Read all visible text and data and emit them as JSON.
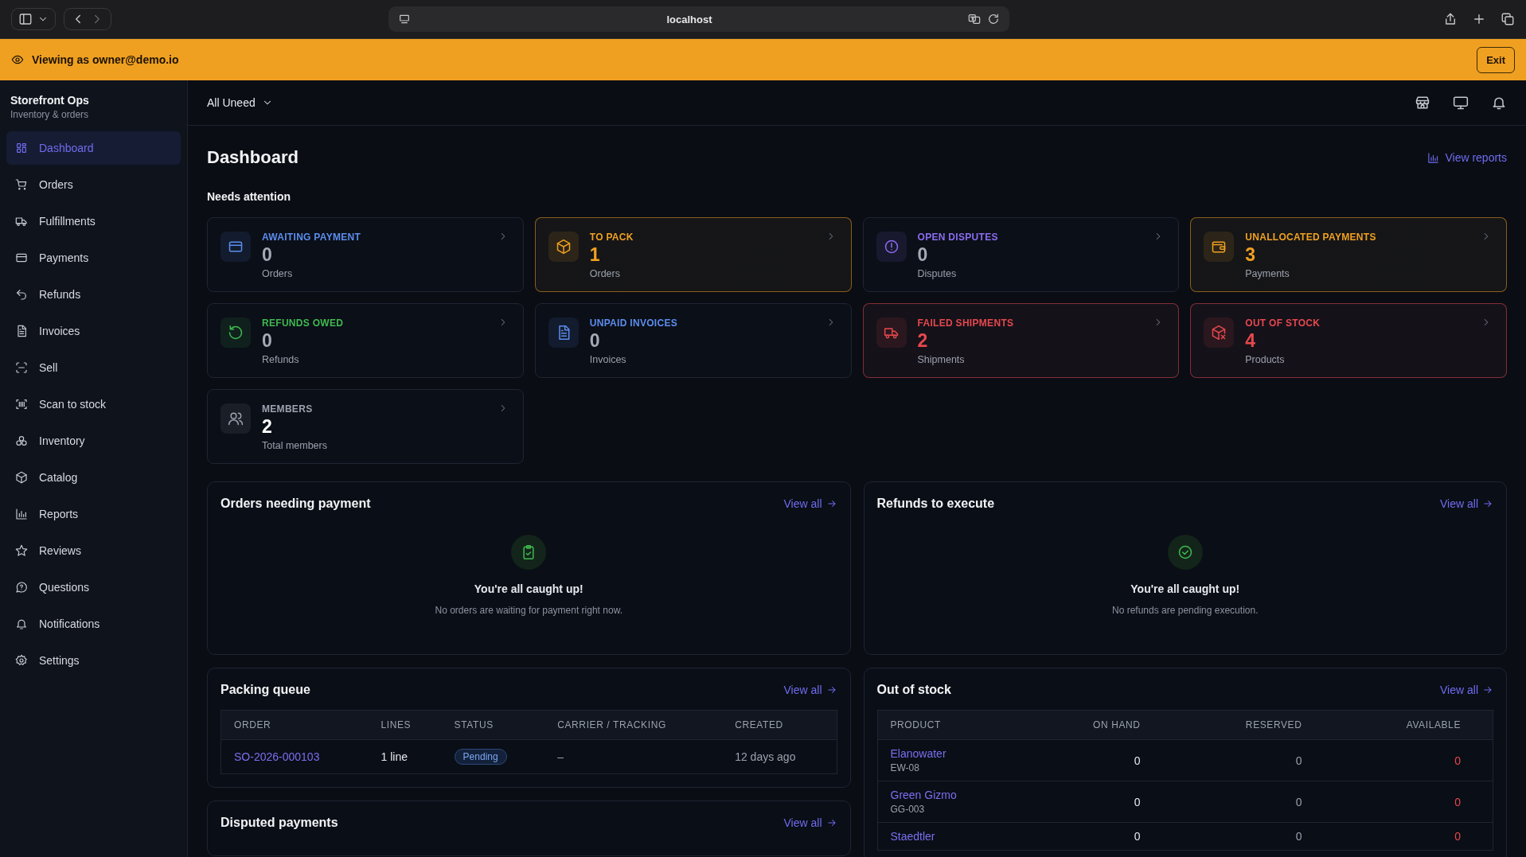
{
  "browser": {
    "address": "localhost"
  },
  "banner": {
    "text": "Viewing as owner@demo.io",
    "button": "Exit"
  },
  "sidebar": {
    "title": "Storefront Ops",
    "subtitle": "Inventory & orders",
    "items": [
      {
        "label": "Dashboard",
        "selected": true
      },
      {
        "label": "Orders",
        "selected": false
      },
      {
        "label": "Fulfillments",
        "selected": false
      },
      {
        "label": "Payments",
        "selected": false
      },
      {
        "label": "Refunds",
        "selected": false
      },
      {
        "label": "Invoices",
        "selected": false
      },
      {
        "label": "Sell",
        "selected": false
      },
      {
        "label": "Scan to stock",
        "selected": false
      },
      {
        "label": "Inventory",
        "selected": false
      },
      {
        "label": "Catalog",
        "selected": false
      },
      {
        "label": "Reports",
        "selected": false
      },
      {
        "label": "Reviews",
        "selected": false
      },
      {
        "label": "Questions",
        "selected": false
      },
      {
        "label": "Notifications",
        "selected": false
      },
      {
        "label": "Settings",
        "selected": false
      }
    ]
  },
  "topbar": {
    "selector": "All Uneed"
  },
  "page": {
    "title": "Dashboard",
    "action": "View reports",
    "section": "Needs attention"
  },
  "cards": [
    {
      "label": "AWAITING PAYMENT",
      "count": "0",
      "unit": "Orders",
      "color": "#5b8def",
      "highlighted": false,
      "dimmed": true
    },
    {
      "label": "TO PACK",
      "count": "1",
      "unit": "Orders",
      "color": "#f0a020",
      "highlighted": true,
      "dimmed": false
    },
    {
      "label": "OPEN DISPUTES",
      "count": "0",
      "unit": "Disputes",
      "color": "#8b6cf0",
      "highlighted": false,
      "dimmed": true
    },
    {
      "label": "UNALLOCATED PAYMENTS",
      "count": "3",
      "unit": "Payments",
      "color": "#f0a020",
      "highlighted": true,
      "dimmed": false
    },
    {
      "label": "REFUNDS OWED",
      "count": "0",
      "unit": "Refunds",
      "color": "#3fb950",
      "highlighted": false,
      "dimmed": true
    },
    {
      "label": "UNPAID INVOICES",
      "count": "0",
      "unit": "Invoices",
      "color": "#5b8def",
      "highlighted": false,
      "dimmed": true
    },
    {
      "label": "FAILED SHIPMENTS",
      "count": "2",
      "unit": "Shipments",
      "color": "#e5484d",
      "highlighted": true,
      "dimmed": false
    },
    {
      "label": "OUT OF STOCK",
      "count": "4",
      "unit": "Products",
      "color": "#e5484d",
      "highlighted": true,
      "dimmed": false
    },
    {
      "label": "MEMBERS",
      "count": "2",
      "unit": "Total members",
      "color": "#9ca3af",
      "highlighted": false,
      "dimmed": false
    }
  ],
  "panels": [
    {
      "kind": "empty",
      "title": "Orders needing payment",
      "link": "View all",
      "heading": "You're all caught up!",
      "message": "No orders are waiting for payment right now."
    },
    {
      "kind": "empty",
      "title": "Refunds to execute",
      "link": "View all",
      "heading": "You're all caught up!",
      "message": "No refunds are pending execution."
    },
    {
      "kind": "packing",
      "title": "Packing queue",
      "link": "View all",
      "columns": [
        "ORDER",
        "LINES",
        "STATUS",
        "CARRIER / TRACKING",
        "CREATED"
      ],
      "rows": [
        {
          "order": "SO-2026-000103",
          "lines": "1 line",
          "status": "Pending",
          "carrier": "–",
          "created": "12 days ago"
        }
      ]
    },
    {
      "kind": "stock",
      "title": "Out of stock",
      "link": "View all",
      "columns": [
        "PRODUCT",
        "ON HAND",
        "RESERVED",
        "AVAILABLE"
      ],
      "rows": [
        {
          "product": "Elanowater",
          "sku": "EW-08",
          "on_hand": "0",
          "reserved": "0",
          "available": "0"
        },
        {
          "product": "Green Gizmo",
          "sku": "GG-003",
          "on_hand": "0",
          "reserved": "0",
          "available": "0"
        },
        {
          "product": "Staedtler",
          "on_hand": "0",
          "reserved": "0",
          "available": "0"
        }
      ]
    },
    {
      "kind": "blank",
      "title": "Disputed payments",
      "link": "View all"
    }
  ]
}
